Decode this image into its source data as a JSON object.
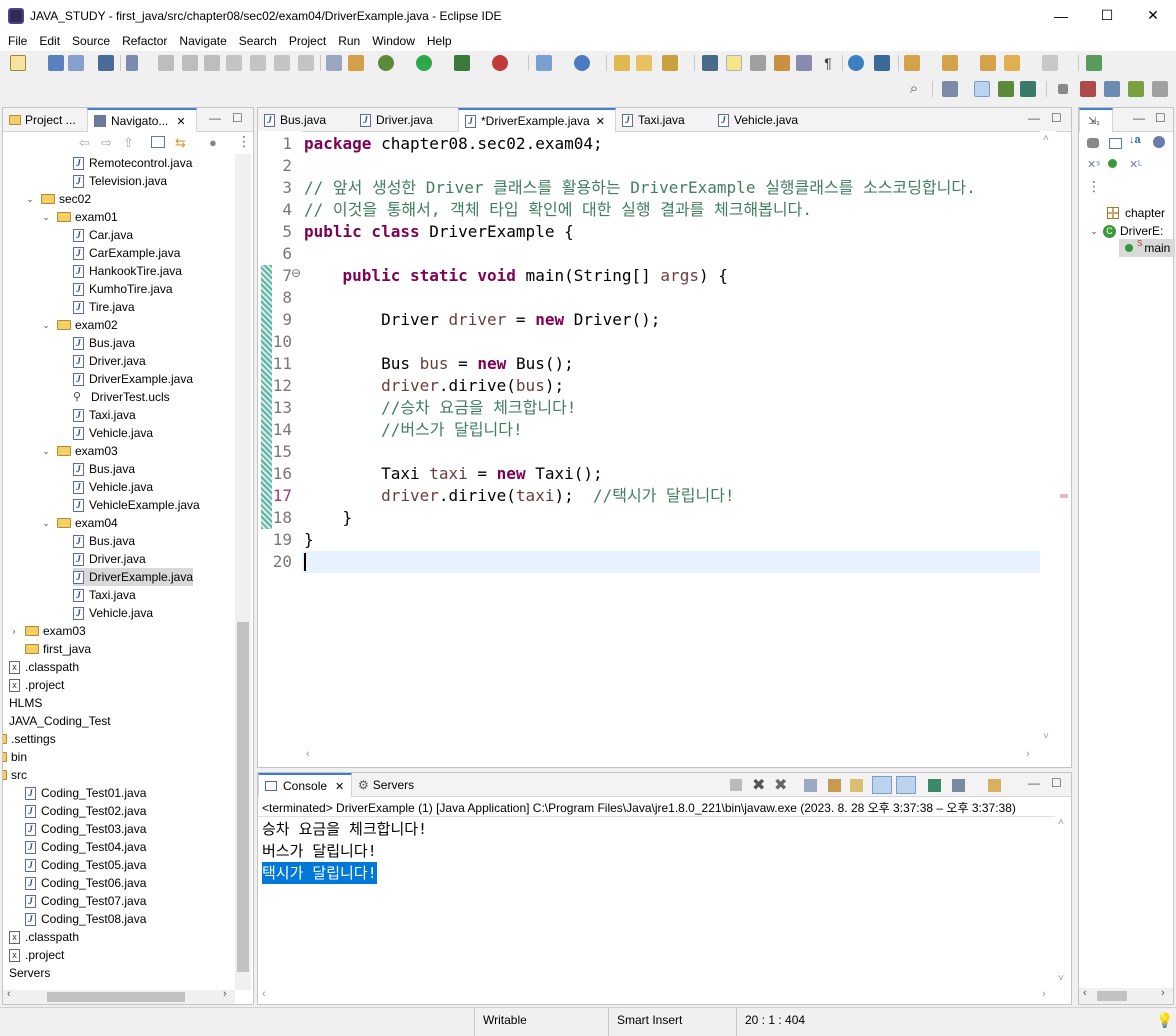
{
  "window": {
    "title": "JAVA_STUDY - first_java/src/chapter08/sec02/exam04/DriverExample.java - Eclipse IDE",
    "minimize": "—",
    "maximize": "☐",
    "close": "✕"
  },
  "menu": [
    "File",
    "Edit",
    "Source",
    "Refactor",
    "Navigate",
    "Search",
    "Project",
    "Run",
    "Window",
    "Help"
  ],
  "left_panel": {
    "tabs": [
      {
        "label": "Project ...",
        "icon": "project-explorer-icon"
      },
      {
        "label": "Navigato...",
        "icon": "navigator-icon",
        "close": "✕"
      }
    ],
    "tree": [
      {
        "label": "Remotecontrol.java",
        "type": "java",
        "indent": 3
      },
      {
        "label": "Television.java",
        "type": "java",
        "indent": 3
      },
      {
        "label": "sec02",
        "type": "folder",
        "indent": 1,
        "expanded": true
      },
      {
        "label": "exam01",
        "type": "folder",
        "indent": 2,
        "expanded": true
      },
      {
        "label": "Car.java",
        "type": "java",
        "indent": 3
      },
      {
        "label": "CarExample.java",
        "type": "java",
        "indent": 3
      },
      {
        "label": "HankookTire.java",
        "type": "java",
        "indent": 3
      },
      {
        "label": "KumhoTire.java",
        "type": "java",
        "indent": 3
      },
      {
        "label": "Tire.java",
        "type": "java",
        "indent": 3
      },
      {
        "label": "exam02",
        "type": "folder",
        "indent": 2,
        "expanded": true
      },
      {
        "label": "Bus.java",
        "type": "java",
        "indent": 3
      },
      {
        "label": "Driver.java",
        "type": "java",
        "indent": 3
      },
      {
        "label": "DriverExample.java",
        "type": "java",
        "indent": 3
      },
      {
        "label": "DriverTest.ucls",
        "type": "ucls",
        "indent": 3
      },
      {
        "label": "Taxi.java",
        "type": "java",
        "indent": 3
      },
      {
        "label": "Vehicle.java",
        "type": "java",
        "indent": 3
      },
      {
        "label": "exam03",
        "type": "folder",
        "indent": 2,
        "expanded": true
      },
      {
        "label": "Bus.java",
        "type": "java",
        "indent": 3
      },
      {
        "label": "Vehicle.java",
        "type": "java",
        "indent": 3
      },
      {
        "label": "VehicleExample.java",
        "type": "java",
        "indent": 3
      },
      {
        "label": "exam04",
        "type": "folder",
        "indent": 2,
        "expanded": true
      },
      {
        "label": "Bus.java",
        "type": "java",
        "indent": 3
      },
      {
        "label": "Driver.java",
        "type": "java",
        "indent": 3
      },
      {
        "label": "DriverExample.java",
        "type": "java",
        "indent": 3,
        "selected": true
      },
      {
        "label": "Taxi.java",
        "type": "java",
        "indent": 3
      },
      {
        "label": "Vehicle.java",
        "type": "java",
        "indent": 3
      },
      {
        "label": "exam03",
        "type": "folder",
        "indent": 0,
        "expanded": false
      },
      {
        "label": "first_java",
        "type": "folder",
        "indent": 0,
        "nochev": true
      },
      {
        "label": ".classpath",
        "type": "x",
        "indent": -1
      },
      {
        "label": ".project",
        "type": "x",
        "indent": -1
      },
      {
        "label": "HLMS",
        "type": "plain",
        "indent": -1
      },
      {
        "label": "JAVA_Coding_Test",
        "type": "plain",
        "indent": -1
      },
      {
        "label": ".settings",
        "type": "folder",
        "indent": -1
      },
      {
        "label": "bin",
        "type": "folder",
        "indent": -1
      },
      {
        "label": "src",
        "type": "folder",
        "indent": -1
      },
      {
        "label": "Coding_Test01.java",
        "type": "java",
        "indent": 0
      },
      {
        "label": "Coding_Test02.java",
        "type": "java",
        "indent": 0
      },
      {
        "label": "Coding_Test03.java",
        "type": "java",
        "indent": 0
      },
      {
        "label": "Coding_Test04.java",
        "type": "java",
        "indent": 0
      },
      {
        "label": "Coding_Test05.java",
        "type": "java",
        "indent": 0
      },
      {
        "label": "Coding_Test06.java",
        "type": "java",
        "indent": 0
      },
      {
        "label": "Coding_Test07.java",
        "type": "java",
        "indent": 0
      },
      {
        "label": "Coding_Test08.java",
        "type": "java",
        "indent": 0
      },
      {
        "label": ".classpath",
        "type": "x",
        "indent": -1
      },
      {
        "label": ".project",
        "type": "x",
        "indent": -1
      },
      {
        "label": "Servers",
        "type": "plain",
        "indent": -1
      }
    ]
  },
  "editor": {
    "tabs": [
      {
        "label": "Bus.java"
      },
      {
        "label": "Driver.java"
      },
      {
        "label": "*DriverExample.java",
        "active": true,
        "close": "✕"
      },
      {
        "label": "Taxi.java"
      },
      {
        "label": "Vehicle.java"
      }
    ],
    "line_numbers": [
      "1",
      "2",
      "3",
      "4",
      "5",
      "6",
      "7",
      "8",
      "9",
      "10",
      "11",
      "12",
      "13",
      "14",
      "15",
      "16",
      "17",
      "18",
      "19",
      "20"
    ],
    "fold_marker": "⊖",
    "lines": {
      "l1_kw": "package",
      "l1_rest": " chapter08.sec02.exam04;",
      "l3": "// 앞서 생성한 Driver 클래스를 활용하는 DriverExample 실행클래스를 소스코딩합니다.",
      "l4": "// 이것을 통해서, 객체 타입 확인에 대한 실행 결과를 체크해봅니다.",
      "l5_kw": "public class",
      "l5_rest": " DriverExample {",
      "l7_indent": "    ",
      "l7_kw": "public static void",
      "l7_mid": " main(String[] ",
      "l7_var": "args",
      "l7_end": ") {",
      "l9_a": "        Driver ",
      "l9_var": "driver",
      "l9_b": " = ",
      "l9_kw": "new",
      "l9_c": " Driver();",
      "l11_a": "        Bus ",
      "l11_var": "bus",
      "l11_b": " = ",
      "l11_kw": "new",
      "l11_c": " Bus();",
      "l12_indent": "        ",
      "l12_var": "driver",
      "l12_mid": ".dirive(",
      "l12_var2": "bus",
      "l12_end": ");",
      "l13": "        //승차 요금을 체크합니다!",
      "l14": "        //버스가 달립니다!",
      "l16_a": "        Taxi ",
      "l16_var": "taxi",
      "l16_b": " = ",
      "l16_kw": "new",
      "l16_c": " Taxi();",
      "l17_indent": "        ",
      "l17_var": "driver",
      "l17_mid": ".dirive(",
      "l17_var2": "taxi",
      "l17_end": ");  ",
      "l17_cm": "//택시가 달립니다!",
      "l18": "    }",
      "l19": "}"
    }
  },
  "right_panel": {
    "items": [
      {
        "label": "chapter",
        "icon": "package-icon"
      },
      {
        "label": "DriverE:",
        "icon": "class-icon"
      },
      {
        "label": "main",
        "icon": "method-icon"
      }
    ]
  },
  "console": {
    "tabs": [
      {
        "label": "Console",
        "active": true,
        "close": "✕"
      },
      {
        "label": "Servers"
      }
    ],
    "header": "<terminated> DriverExample (1) [Java Application] C:\\Program Files\\Java\\jre1.8.0_221\\bin\\javaw.exe  (2023. 8. 28 오후 3:37:38 – 오후 3:37:38)",
    "output": [
      "승차 요금을 체크합니다!",
      "버스가 달립니다!",
      "택시가 달립니다!"
    ]
  },
  "status": {
    "writable": "Writable",
    "insert": "Smart Insert",
    "position": "20 : 1 : 404"
  },
  "colors": {
    "keyword": "#7f0055",
    "comment": "#3f7f5f",
    "variable": "#6a3e3e",
    "selection": "#0078d7",
    "active_tab": "#3c80d2"
  }
}
